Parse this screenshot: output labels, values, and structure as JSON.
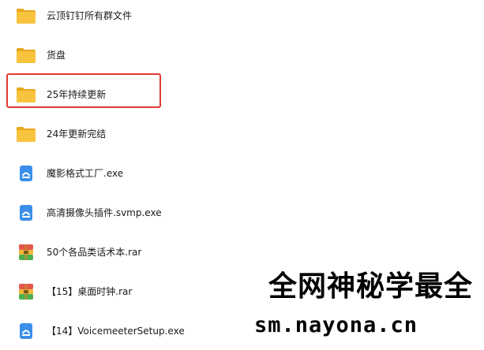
{
  "files": [
    {
      "name": "云顶钉钉所有群文件",
      "type": "folder",
      "icon": "folder-icon"
    },
    {
      "name": "货盘",
      "type": "folder",
      "icon": "folder-icon"
    },
    {
      "name": "25年持续更新",
      "type": "folder",
      "icon": "folder-icon",
      "highlighted": true
    },
    {
      "name": "24年更新完结",
      "type": "folder",
      "icon": "folder-icon"
    },
    {
      "name": "魔影格式工厂.exe",
      "type": "exe",
      "icon": "installer-icon"
    },
    {
      "name": "高清摄像头插件.svmp.exe",
      "type": "exe",
      "icon": "installer-icon"
    },
    {
      "name": "50个各品类话术本.rar",
      "type": "rar",
      "icon": "archive-icon"
    },
    {
      "name": "【15】桌面时钟.rar",
      "type": "rar",
      "icon": "archive-icon"
    },
    {
      "name": "【14】VoicemeeterSetup.exe",
      "type": "exe",
      "icon": "installer-icon"
    }
  ],
  "watermark": {
    "line1": "全网神秘学最全",
    "line2": "sm.nayona.cn"
  },
  "colors": {
    "folder": "#f8c33d",
    "folder_tab": "#e8a81e",
    "installer": "#3b8fea",
    "archive_top": "#e2574c",
    "archive_mid": "#f5b83d",
    "archive_bottom": "#4caf50",
    "highlight_border": "#e53935"
  }
}
